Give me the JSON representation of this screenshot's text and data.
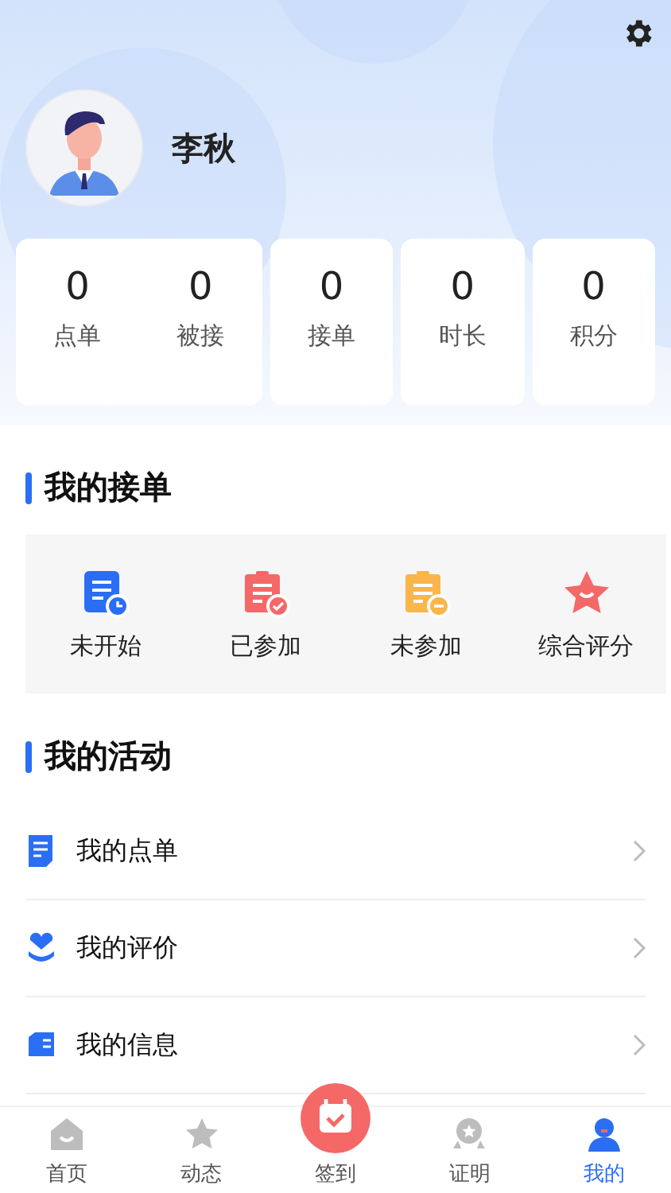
{
  "profile": {
    "name": "李秋"
  },
  "stats": {
    "pair": [
      {
        "value": "0",
        "label": "点单"
      },
      {
        "value": "0",
        "label": "被接"
      }
    ],
    "singles": [
      {
        "value": "0",
        "label": "接单"
      },
      {
        "value": "0",
        "label": "时长"
      },
      {
        "value": "0",
        "label": "积分"
      }
    ]
  },
  "orders_section": {
    "title": "我的接单",
    "items": [
      {
        "label": "未开始",
        "kind": "pending"
      },
      {
        "label": "已参加",
        "kind": "joined"
      },
      {
        "label": "未参加",
        "kind": "missed"
      },
      {
        "label": "综合评分",
        "kind": "rating"
      }
    ]
  },
  "activity_section": {
    "title": "我的活动",
    "items": [
      {
        "label": "我的点单",
        "kind": "orders"
      },
      {
        "label": "我的评价",
        "kind": "reviews"
      },
      {
        "label": "我的信息",
        "kind": "info"
      }
    ]
  },
  "tab_bar": [
    {
      "label": "首页",
      "kind": "home",
      "selected": false
    },
    {
      "label": "动态",
      "kind": "feed",
      "selected": false
    },
    {
      "label": "签到",
      "kind": "checkin",
      "selected": false
    },
    {
      "label": "证明",
      "kind": "badge",
      "selected": false
    },
    {
      "label": "我的",
      "kind": "me",
      "selected": true
    }
  ]
}
